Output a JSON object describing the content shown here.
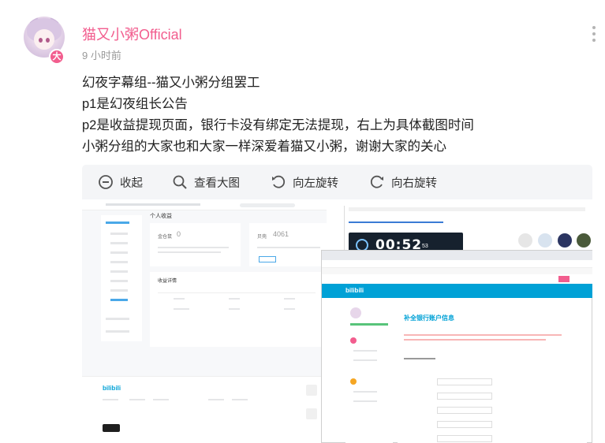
{
  "post": {
    "username": "猫又小粥Official",
    "time": "9 小时前",
    "badge": "大",
    "lines": [
      "幻夜字幕组--猫又小粥分组罢工",
      "p1是幻夜组长公告",
      "p2是收益提现页面，银行卡没有绑定无法提现，右上为具体截图时间",
      "小粥分组的大家也和大家一样深爱着猫又小粥，谢谢大家的关心"
    ]
  },
  "viewer": {
    "toolbar": [
      {
        "label": "收起",
        "icon": "collapse-icon"
      },
      {
        "label": "查看大图",
        "icon": "search-icon"
      },
      {
        "label": "向左旋转",
        "icon": "rotate-left-icon"
      },
      {
        "label": "向右旋转",
        "icon": "rotate-right-icon"
      }
    ]
  },
  "screenshot": {
    "personal_income": "个人收益",
    "balance_label": "金仓鼠",
    "balance_value": "0",
    "points_label": "贝壳",
    "points_value": "4061",
    "income_details": "收益详情",
    "clock_time": "00:52",
    "clock_seconds": "53",
    "bank_title": "补全银行账户信息",
    "bili_logo": "bilibili"
  },
  "colors": {
    "accent_pink": "#f25d8e",
    "bili_blue": "#00a1d6",
    "viewer_bg": "#f4f5f7"
  }
}
